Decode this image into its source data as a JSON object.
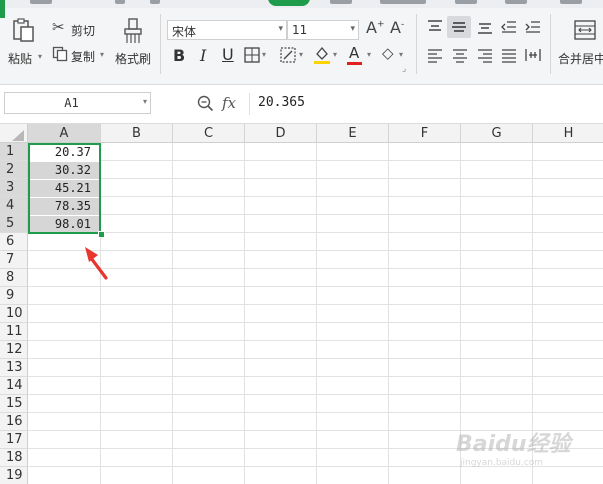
{
  "ribbon": {
    "clipboard": {
      "paste": "粘贴",
      "cut": "剪切",
      "copy": "复制",
      "format_painter": "格式刷"
    },
    "font": {
      "name": "宋体",
      "size": "11",
      "bold": "B",
      "italic": "I",
      "underline": "U"
    },
    "alignment": {
      "merge_center": "合并居中"
    }
  },
  "formula_bar": {
    "name_box": "A1",
    "fx": "fx",
    "value": "20.365"
  },
  "sheet": {
    "columns": [
      "A",
      "B",
      "C",
      "D",
      "E",
      "F",
      "G",
      "H"
    ],
    "rows": [
      "1",
      "2",
      "3",
      "4",
      "5",
      "6",
      "7",
      "8",
      "9",
      "10",
      "11",
      "12",
      "13",
      "14",
      "15",
      "16",
      "17",
      "18",
      "19"
    ],
    "cells": [
      "20.37",
      "30.32",
      "45.21",
      "78.35",
      "98.01"
    ]
  },
  "watermark": {
    "text": "Baidu经验",
    "sub": "jingyan.baidu.com"
  },
  "colors": {
    "accent": "#1f9b4c",
    "arrow": "#e8352e"
  }
}
